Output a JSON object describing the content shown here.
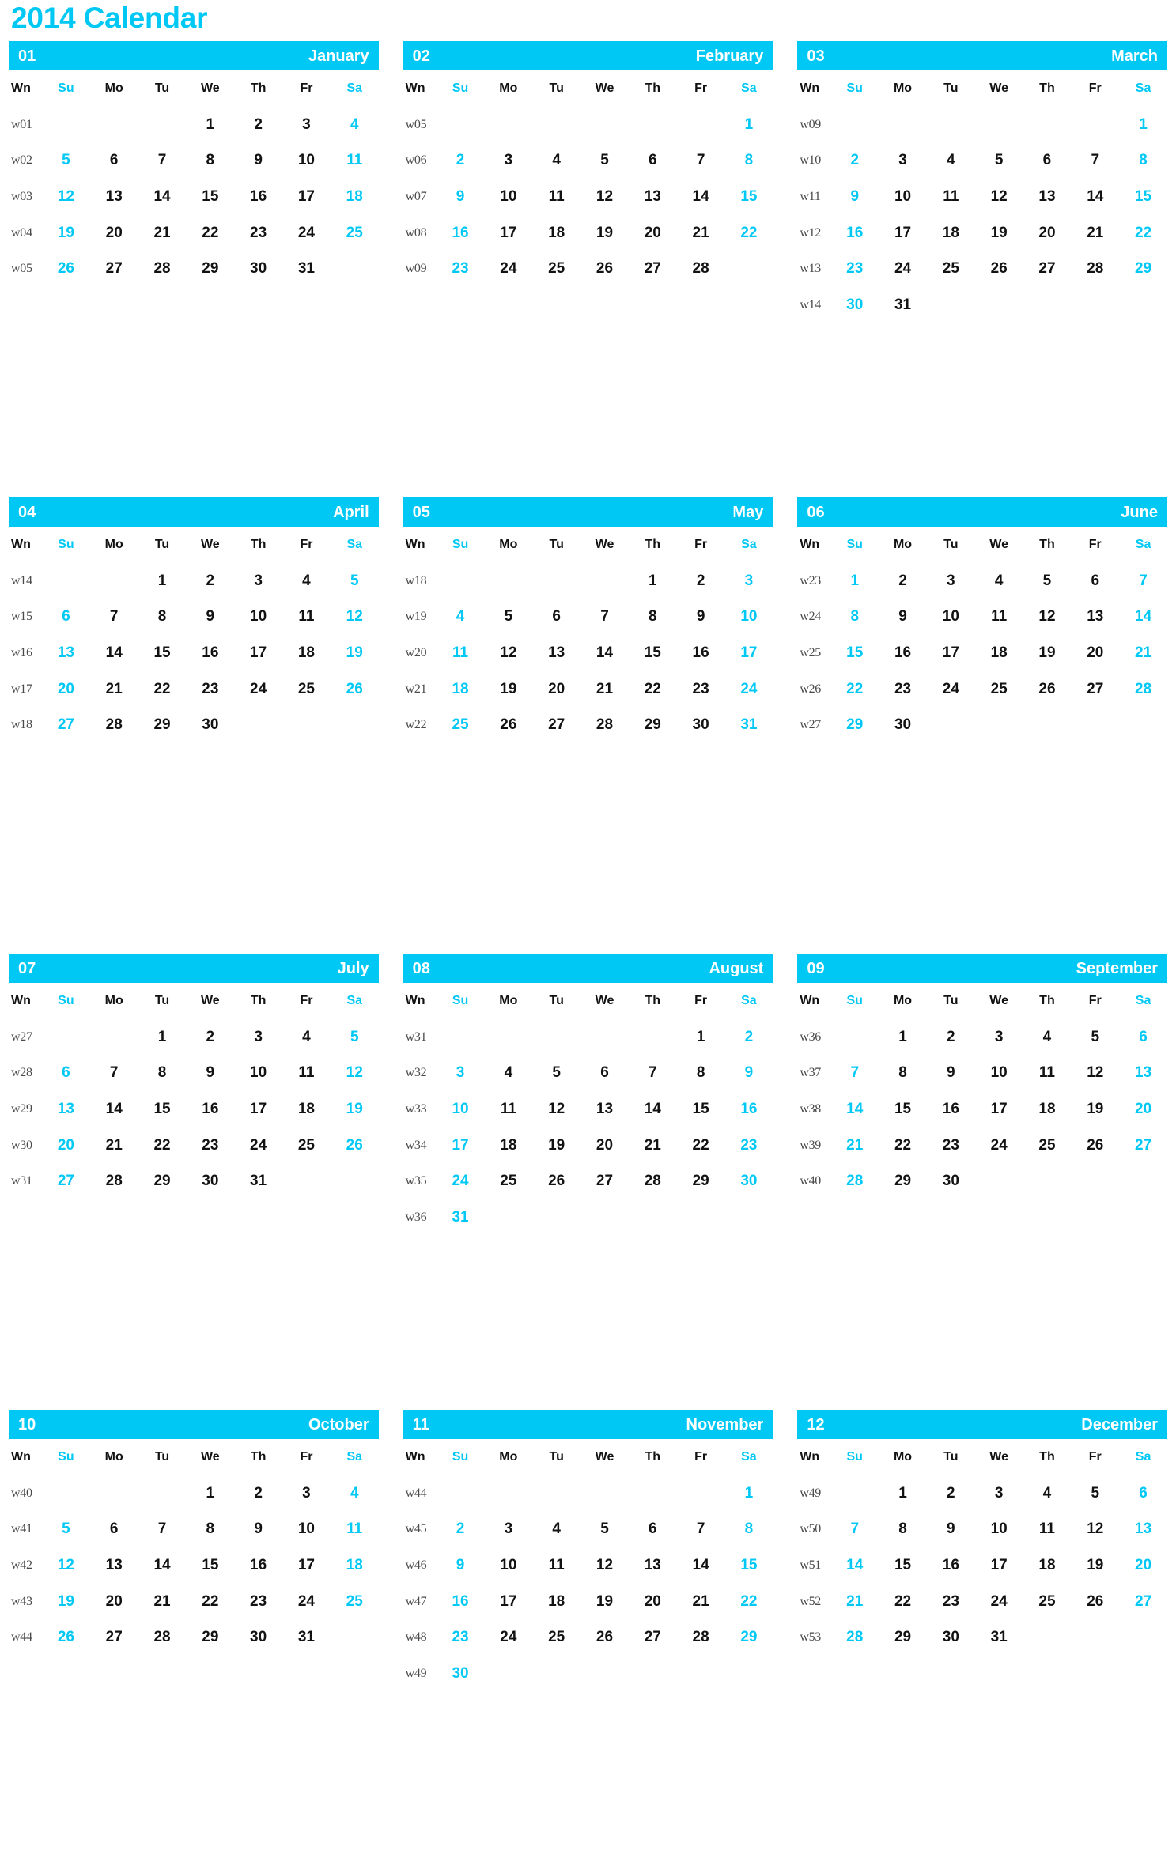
{
  "title": "2014 Calendar",
  "colors": {
    "accent": "#00c8f5",
    "text": "#121212",
    "weeknum": "#4a4a4a",
    "header_text": "#ffffff",
    "background": "#ffffff"
  },
  "weekday_headers": [
    {
      "label": "Wn",
      "weekend": false
    },
    {
      "label": "Su",
      "weekend": true
    },
    {
      "label": "Mo",
      "weekend": false
    },
    {
      "label": "Tu",
      "weekend": false
    },
    {
      "label": "We",
      "weekend": false
    },
    {
      "label": "Th",
      "weekend": false
    },
    {
      "label": "Fr",
      "weekend": false
    },
    {
      "label": "Sa",
      "weekend": true
    }
  ],
  "months": [
    {
      "number": "01",
      "name": "January",
      "weeks": [
        {
          "wn": "w01",
          "days": [
            "",
            "",
            "",
            "1",
            "2",
            "3",
            "4"
          ]
        },
        {
          "wn": "w02",
          "days": [
            "5",
            "6",
            "7",
            "8",
            "9",
            "10",
            "11"
          ]
        },
        {
          "wn": "w03",
          "days": [
            "12",
            "13",
            "14",
            "15",
            "16",
            "17",
            "18"
          ]
        },
        {
          "wn": "w04",
          "days": [
            "19",
            "20",
            "21",
            "22",
            "23",
            "24",
            "25"
          ]
        },
        {
          "wn": "w05",
          "days": [
            "26",
            "27",
            "28",
            "29",
            "30",
            "31",
            ""
          ]
        }
      ]
    },
    {
      "number": "02",
      "name": "February",
      "weeks": [
        {
          "wn": "w05",
          "days": [
            "",
            "",
            "",
            "",
            "",
            "",
            "1"
          ]
        },
        {
          "wn": "w06",
          "days": [
            "2",
            "3",
            "4",
            "5",
            "6",
            "7",
            "8"
          ]
        },
        {
          "wn": "w07",
          "days": [
            "9",
            "10",
            "11",
            "12",
            "13",
            "14",
            "15"
          ]
        },
        {
          "wn": "w08",
          "days": [
            "16",
            "17",
            "18",
            "19",
            "20",
            "21",
            "22"
          ]
        },
        {
          "wn": "w09",
          "days": [
            "23",
            "24",
            "25",
            "26",
            "27",
            "28",
            ""
          ]
        }
      ]
    },
    {
      "number": "03",
      "name": "March",
      "weeks": [
        {
          "wn": "w09",
          "days": [
            "",
            "",
            "",
            "",
            "",
            "",
            "1"
          ]
        },
        {
          "wn": "w10",
          "days": [
            "2",
            "3",
            "4",
            "5",
            "6",
            "7",
            "8"
          ]
        },
        {
          "wn": "w11",
          "days": [
            "9",
            "10",
            "11",
            "12",
            "13",
            "14",
            "15"
          ]
        },
        {
          "wn": "w12",
          "days": [
            "16",
            "17",
            "18",
            "19",
            "20",
            "21",
            "22"
          ]
        },
        {
          "wn": "w13",
          "days": [
            "23",
            "24",
            "25",
            "26",
            "27",
            "28",
            "29"
          ]
        },
        {
          "wn": "w14",
          "days": [
            "30",
            "31",
            "",
            "",
            "",
            "",
            ""
          ]
        }
      ]
    },
    {
      "number": "04",
      "name": "April",
      "weeks": [
        {
          "wn": "w14",
          "days": [
            "",
            "",
            "1",
            "2",
            "3",
            "4",
            "5"
          ]
        },
        {
          "wn": "w15",
          "days": [
            "6",
            "7",
            "8",
            "9",
            "10",
            "11",
            "12"
          ]
        },
        {
          "wn": "w16",
          "days": [
            "13",
            "14",
            "15",
            "16",
            "17",
            "18",
            "19"
          ]
        },
        {
          "wn": "w17",
          "days": [
            "20",
            "21",
            "22",
            "23",
            "24",
            "25",
            "26"
          ]
        },
        {
          "wn": "w18",
          "days": [
            "27",
            "28",
            "29",
            "30",
            "",
            "",
            ""
          ]
        }
      ]
    },
    {
      "number": "05",
      "name": "May",
      "weeks": [
        {
          "wn": "w18",
          "days": [
            "",
            "",
            "",
            "",
            "1",
            "2",
            "3"
          ]
        },
        {
          "wn": "w19",
          "days": [
            "4",
            "5",
            "6",
            "7",
            "8",
            "9",
            "10"
          ]
        },
        {
          "wn": "w20",
          "days": [
            "11",
            "12",
            "13",
            "14",
            "15",
            "16",
            "17"
          ]
        },
        {
          "wn": "w21",
          "days": [
            "18",
            "19",
            "20",
            "21",
            "22",
            "23",
            "24"
          ]
        },
        {
          "wn": "w22",
          "days": [
            "25",
            "26",
            "27",
            "28",
            "29",
            "30",
            "31"
          ]
        }
      ]
    },
    {
      "number": "06",
      "name": "June",
      "weeks": [
        {
          "wn": "w23",
          "days": [
            "1",
            "2",
            "3",
            "4",
            "5",
            "6",
            "7"
          ]
        },
        {
          "wn": "w24",
          "days": [
            "8",
            "9",
            "10",
            "11",
            "12",
            "13",
            "14"
          ]
        },
        {
          "wn": "w25",
          "days": [
            "15",
            "16",
            "17",
            "18",
            "19",
            "20",
            "21"
          ]
        },
        {
          "wn": "w26",
          "days": [
            "22",
            "23",
            "24",
            "25",
            "26",
            "27",
            "28"
          ]
        },
        {
          "wn": "w27",
          "days": [
            "29",
            "30",
            "",
            "",
            "",
            "",
            ""
          ]
        }
      ]
    },
    {
      "number": "07",
      "name": "July",
      "weeks": [
        {
          "wn": "w27",
          "days": [
            "",
            "",
            "1",
            "2",
            "3",
            "4",
            "5"
          ]
        },
        {
          "wn": "w28",
          "days": [
            "6",
            "7",
            "8",
            "9",
            "10",
            "11",
            "12"
          ]
        },
        {
          "wn": "w29",
          "days": [
            "13",
            "14",
            "15",
            "16",
            "17",
            "18",
            "19"
          ]
        },
        {
          "wn": "w30",
          "days": [
            "20",
            "21",
            "22",
            "23",
            "24",
            "25",
            "26"
          ]
        },
        {
          "wn": "w31",
          "days": [
            "27",
            "28",
            "29",
            "30",
            "31",
            "",
            ""
          ]
        }
      ]
    },
    {
      "number": "08",
      "name": "August",
      "weeks": [
        {
          "wn": "w31",
          "days": [
            "",
            "",
            "",
            "",
            "",
            "1",
            "2"
          ]
        },
        {
          "wn": "w32",
          "days": [
            "3",
            "4",
            "5",
            "6",
            "7",
            "8",
            "9"
          ]
        },
        {
          "wn": "w33",
          "days": [
            "10",
            "11",
            "12",
            "13",
            "14",
            "15",
            "16"
          ]
        },
        {
          "wn": "w34",
          "days": [
            "17",
            "18",
            "19",
            "20",
            "21",
            "22",
            "23"
          ]
        },
        {
          "wn": "w35",
          "days": [
            "24",
            "25",
            "26",
            "27",
            "28",
            "29",
            "30"
          ]
        },
        {
          "wn": "w36",
          "days": [
            "31",
            "",
            "",
            "",
            "",
            "",
            ""
          ]
        }
      ]
    },
    {
      "number": "09",
      "name": "September",
      "weeks": [
        {
          "wn": "w36",
          "days": [
            "",
            "1",
            "2",
            "3",
            "4",
            "5",
            "6"
          ]
        },
        {
          "wn": "w37",
          "days": [
            "7",
            "8",
            "9",
            "10",
            "11",
            "12",
            "13"
          ]
        },
        {
          "wn": "w38",
          "days": [
            "14",
            "15",
            "16",
            "17",
            "18",
            "19",
            "20"
          ]
        },
        {
          "wn": "w39",
          "days": [
            "21",
            "22",
            "23",
            "24",
            "25",
            "26",
            "27"
          ]
        },
        {
          "wn": "w40",
          "days": [
            "28",
            "29",
            "30",
            "",
            "",
            "",
            ""
          ]
        }
      ]
    },
    {
      "number": "10",
      "name": "October",
      "weeks": [
        {
          "wn": "w40",
          "days": [
            "",
            "",
            "",
            "1",
            "2",
            "3",
            "4"
          ]
        },
        {
          "wn": "w41",
          "days": [
            "5",
            "6",
            "7",
            "8",
            "9",
            "10",
            "11"
          ]
        },
        {
          "wn": "w42",
          "days": [
            "12",
            "13",
            "14",
            "15",
            "16",
            "17",
            "18"
          ]
        },
        {
          "wn": "w43",
          "days": [
            "19",
            "20",
            "21",
            "22",
            "23",
            "24",
            "25"
          ]
        },
        {
          "wn": "w44",
          "days": [
            "26",
            "27",
            "28",
            "29",
            "30",
            "31",
            ""
          ]
        }
      ]
    },
    {
      "number": "11",
      "name": "November",
      "weeks": [
        {
          "wn": "w44",
          "days": [
            "",
            "",
            "",
            "",
            "",
            "",
            "1"
          ]
        },
        {
          "wn": "w45",
          "days": [
            "2",
            "3",
            "4",
            "5",
            "6",
            "7",
            "8"
          ]
        },
        {
          "wn": "w46",
          "days": [
            "9",
            "10",
            "11",
            "12",
            "13",
            "14",
            "15"
          ]
        },
        {
          "wn": "w47",
          "days": [
            "16",
            "17",
            "18",
            "19",
            "20",
            "21",
            "22"
          ]
        },
        {
          "wn": "w48",
          "days": [
            "23",
            "24",
            "25",
            "26",
            "27",
            "28",
            "29"
          ]
        },
        {
          "wn": "w49",
          "days": [
            "30",
            "",
            "",
            "",
            "",
            "",
            ""
          ]
        }
      ]
    },
    {
      "number": "12",
      "name": "December",
      "weeks": [
        {
          "wn": "w49",
          "days": [
            "",
            "1",
            "2",
            "3",
            "4",
            "5",
            "6"
          ]
        },
        {
          "wn": "w50",
          "days": [
            "7",
            "8",
            "9",
            "10",
            "11",
            "12",
            "13"
          ]
        },
        {
          "wn": "w51",
          "days": [
            "14",
            "15",
            "16",
            "17",
            "18",
            "19",
            "20"
          ]
        },
        {
          "wn": "w52",
          "days": [
            "21",
            "22",
            "23",
            "24",
            "25",
            "26",
            "27"
          ]
        },
        {
          "wn": "w53",
          "days": [
            "28",
            "29",
            "30",
            "31",
            "",
            "",
            ""
          ]
        }
      ]
    }
  ]
}
